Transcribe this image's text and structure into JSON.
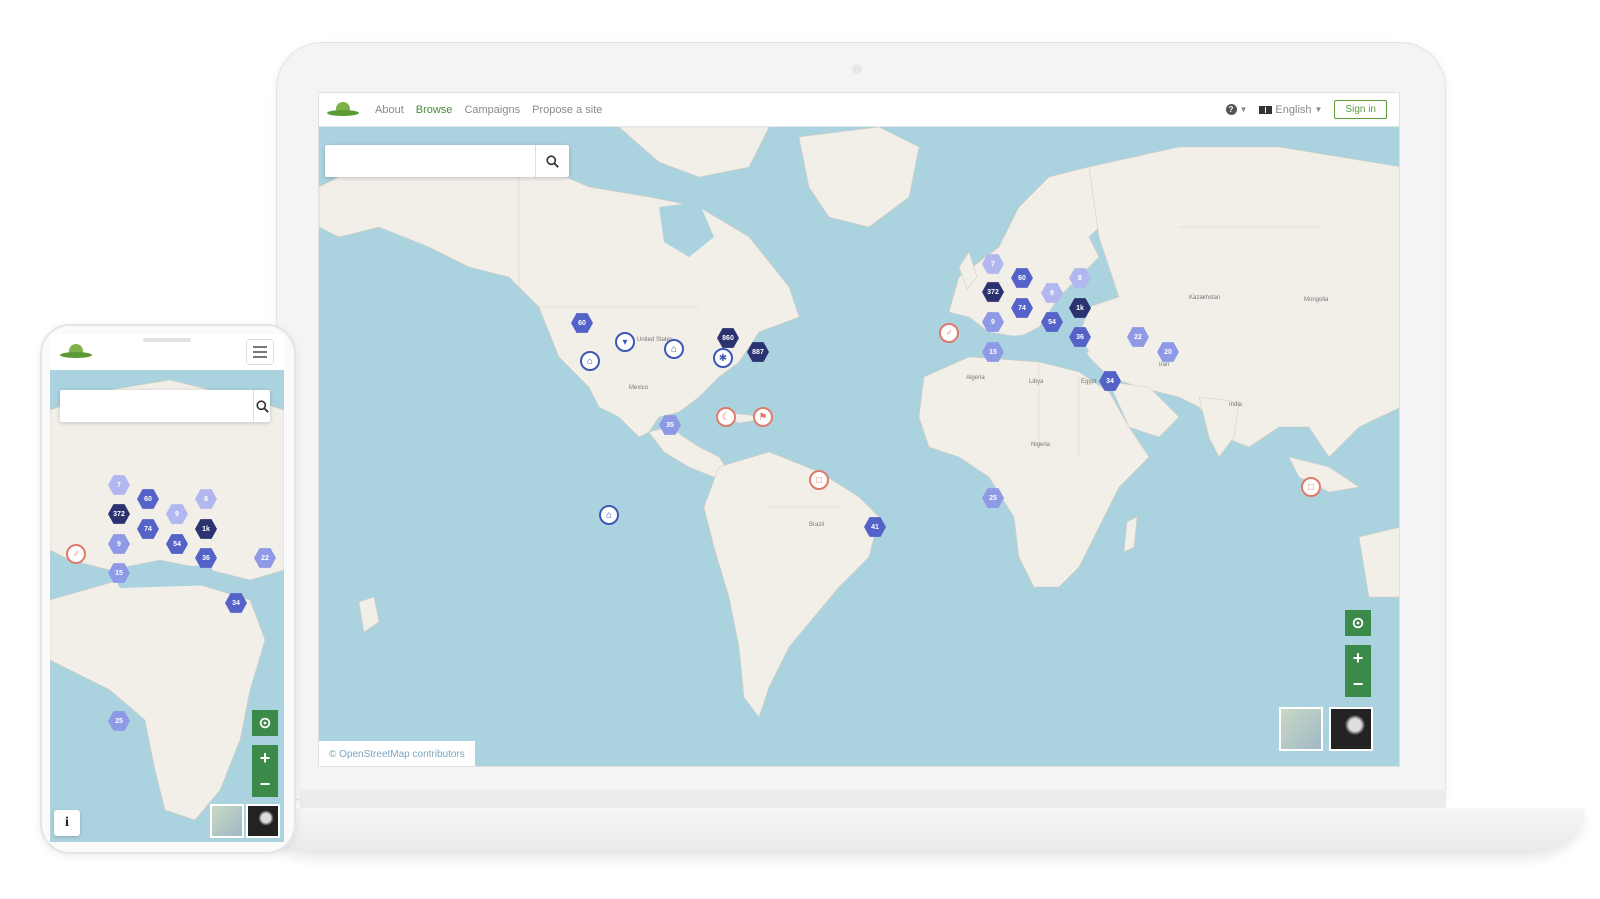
{
  "navbar": {
    "links": [
      "About",
      "Browse",
      "Campaigns",
      "Propose a site"
    ],
    "active": "Browse",
    "help_icon": "question-circle-icon",
    "language": "English",
    "signin_label": "Sign in"
  },
  "search": {
    "placeholder": "",
    "icon": "search-icon"
  },
  "map": {
    "attribution": "© OpenStreetMap contributors",
    "clusters": [
      {
        "label": "7"
      },
      {
        "label": "60"
      },
      {
        "label": "8"
      },
      {
        "label": "372"
      },
      {
        "label": "9"
      },
      {
        "label": "74"
      },
      {
        "label": "1k"
      },
      {
        "label": "9"
      },
      {
        "label": "54"
      },
      {
        "label": "36"
      },
      {
        "label": "15"
      },
      {
        "label": "22"
      },
      {
        "label": "20"
      },
      {
        "label": "34"
      },
      {
        "label": "60"
      },
      {
        "label": "860"
      },
      {
        "label": "887"
      },
      {
        "label": "35"
      },
      {
        "label": "25"
      },
      {
        "label": "41"
      }
    ],
    "place_labels": [
      "United States",
      "Mexico",
      "Brazil",
      "Algeria",
      "Libya",
      "Egypt",
      "Nigeria",
      "Kazakhstan",
      "Mongolia",
      "India",
      "Iran"
    ],
    "controls": {
      "locate_icon": "crosshair-icon",
      "zoom_in": "+",
      "zoom_out": "−"
    },
    "layers": [
      "map-layer-thumbnail",
      "satellite-layer-thumbnail"
    ]
  },
  "phone": {
    "menu_icon": "hamburger-icon",
    "info_label": "i",
    "clusters": [
      {
        "label": "7"
      },
      {
        "label": "60"
      },
      {
        "label": "8"
      },
      {
        "label": "372"
      },
      {
        "label": "9"
      },
      {
        "label": "74"
      },
      {
        "label": "1k"
      },
      {
        "label": "9"
      },
      {
        "label": "54"
      },
      {
        "label": "36"
      },
      {
        "label": "15"
      },
      {
        "label": "22"
      },
      {
        "label": "34"
      },
      {
        "label": "25"
      }
    ]
  },
  "colors": {
    "brand_green": "#5c9a35",
    "control_green": "#3c8a4a",
    "ocean": "#abd3df",
    "land": "#f2efe9",
    "cluster_dark": "#2a3270",
    "cluster_mid": "#5563c9",
    "cluster_light": "#8f9ae6"
  }
}
